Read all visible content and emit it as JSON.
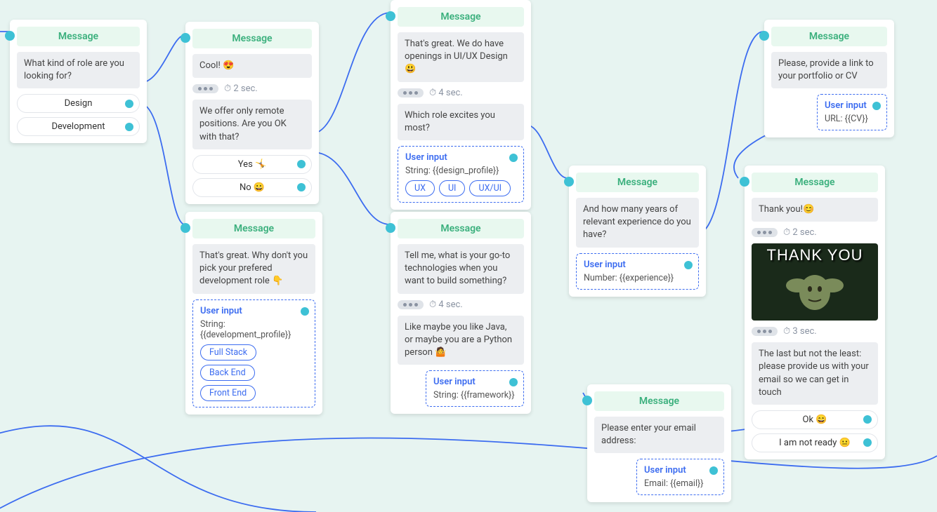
{
  "nodes": {
    "n1": {
      "title": "Message",
      "text1": "What kind of role are you looking for?",
      "opt1": "Design",
      "opt2": "Development"
    },
    "n2": {
      "title": "Message",
      "text1": "Cool! 😍",
      "delay": "⏱ 2 sec.",
      "text2": "We offer only remote positions. Are you OK with that?",
      "opt1": "Yes 🤸",
      "opt2": "No 😀"
    },
    "n3": {
      "title": "Message",
      "text1": "That's great. We do have openings in UI/UX Design 😃",
      "delay": "⏱ 4 sec.",
      "text2": "Which role excites you most?",
      "ui_label": "User input",
      "ui_val": "String: {{design_profile}}",
      "chip1": "UX",
      "chip2": "UI",
      "chip3": "UX/UI"
    },
    "n4": {
      "title": "Message",
      "text1": "That's great. Why don't you pick your prefered development role 👇",
      "ui_label": "User input",
      "ui_val": "String: {{development_profile}}",
      "chip1": "Full Stack",
      "chip2": "Back End",
      "chip3": "Front End"
    },
    "n5": {
      "title": "Message",
      "text1": "Tell me, what is your go-to technologies when you want to build something?",
      "delay": "⏱ 4 sec.",
      "text2": "Like maybe you like Java, or maybe you are a Python person 🤷",
      "ui_label": "User input",
      "ui_val": "String: {{framework}}"
    },
    "n6": {
      "title": "Message",
      "text1": "And how many years of relevant experience do you have?",
      "ui_label": "User input",
      "ui_val": "Number: {{experience}}"
    },
    "n7": {
      "title": "Message",
      "text1": "Please, provide a link to your portfolio or CV",
      "ui_label": "User input",
      "ui_val": "URL: {{CV}}"
    },
    "n8": {
      "title": "Message",
      "text1": "Thank you!😊",
      "delay1": "⏱ 2 sec.",
      "imgcap": "THANK YOU",
      "delay2": "⏱ 3 sec.",
      "text2": "The last but not the least: please provide us with your email so we can get in touch",
      "opt1": "Ok 😄",
      "opt2": "I am not ready 😐"
    },
    "n9": {
      "title": "Message",
      "text1": "Please enter your email address:",
      "ui_label": "User input",
      "ui_val": "Email: {{email}}"
    }
  }
}
